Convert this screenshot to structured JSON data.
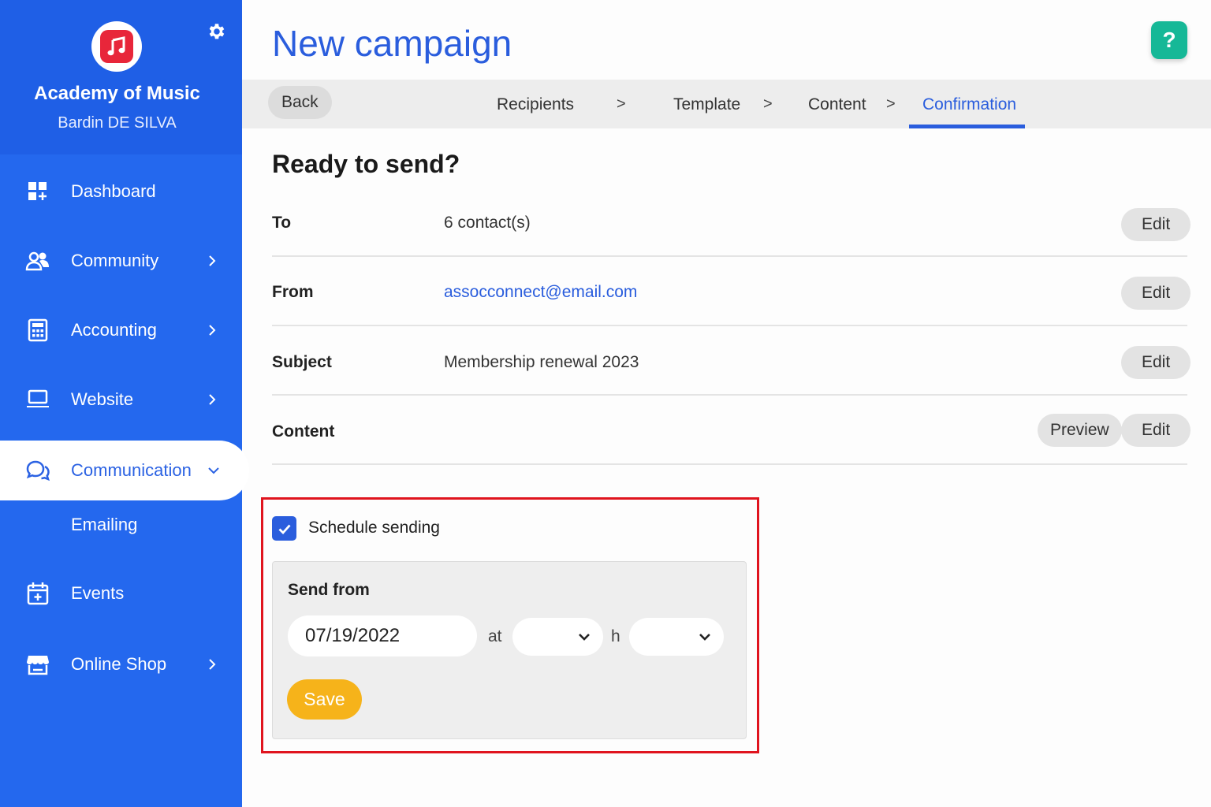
{
  "sidebar": {
    "org_name": "Academy of Music",
    "user_name": "Bardin DE SILVA",
    "items": [
      {
        "label": "Dashboard",
        "icon": "dashboard-icon"
      },
      {
        "label": "Community",
        "icon": "users-icon"
      },
      {
        "label": "Accounting",
        "icon": "calculator-icon"
      },
      {
        "label": "Website",
        "icon": "laptop-icon"
      },
      {
        "label": "Communication",
        "icon": "chat-icon"
      },
      {
        "label": "Emailing"
      },
      {
        "label": "Events",
        "icon": "calendar-plus-icon"
      },
      {
        "label": "Online Shop",
        "icon": "shop-icon"
      }
    ]
  },
  "header": {
    "title": "New campaign",
    "help": "?"
  },
  "steps": {
    "back": "Back",
    "items": [
      "Recipients",
      "Template",
      "Content",
      "Confirmation"
    ],
    "separator": ">"
  },
  "main": {
    "section_title": "Ready to send?",
    "rows": [
      {
        "label": "To",
        "value": "6 contact(s)",
        "action": "Edit"
      },
      {
        "label": "From",
        "value": "assocconnect@email.com",
        "action": "Edit"
      },
      {
        "label": "Subject",
        "value": "Membership renewal 2023",
        "action": "Edit"
      },
      {
        "label": "Content",
        "value": "",
        "preview": "Preview",
        "action": "Edit"
      }
    ]
  },
  "schedule": {
    "checkbox_label": "Schedule sending",
    "checked": true,
    "send_from_label": "Send from",
    "date_value": "07/19/2022",
    "at_label": "at",
    "h_label": "h",
    "save_label": "Save"
  },
  "colors": {
    "sidebar": "#2468ee",
    "accent": "#2a5ddd",
    "help": "#16b897",
    "save": "#f6b31a",
    "highlight": "#e0141e"
  }
}
